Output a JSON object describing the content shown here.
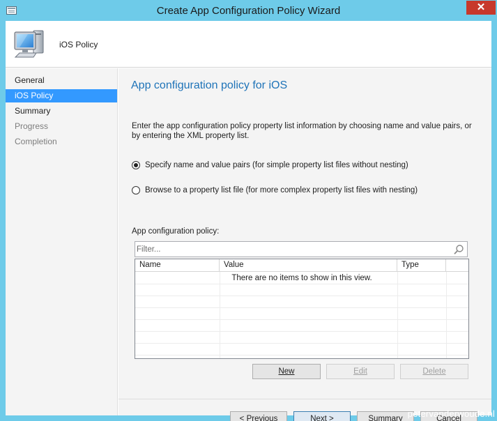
{
  "window": {
    "title": "Create App Configuration Policy Wizard",
    "close_glyph": "✕",
    "icon": "wizard-window-icon"
  },
  "header": {
    "label": "iOS Policy",
    "icon": "computer-monitor-icon"
  },
  "nav": {
    "items": [
      {
        "label": "General",
        "state": "normal"
      },
      {
        "label": "iOS Policy",
        "state": "selected"
      },
      {
        "label": "Summary",
        "state": "normal"
      },
      {
        "label": "Progress",
        "state": "disabled"
      },
      {
        "label": "Completion",
        "state": "disabled"
      }
    ]
  },
  "main": {
    "title": "App configuration policy for iOS",
    "description": "Enter the app configuration policy property list information by choosing name and value pairs, or by entering the XML property list.",
    "options": [
      {
        "label": "Specify name and value pairs (for simple property list files without nesting)",
        "checked": true
      },
      {
        "label": "Browse to a property list file (for more complex property list files with nesting)",
        "checked": false
      }
    ],
    "field_label": "App configuration policy:",
    "filter_placeholder": "Filter...",
    "table": {
      "columns": [
        "Name",
        "Value",
        "Type"
      ],
      "empty_message": "There are no items to show in this view."
    },
    "table_buttons": {
      "new": "New",
      "edit": "Edit",
      "delete": "Delete"
    }
  },
  "footer": {
    "previous": "< Previous",
    "next": "Next >",
    "summary": "Summary",
    "cancel": "Cancel"
  },
  "watermark": "petervanderwoude.nl",
  "colors": {
    "title_bar": "#6ecbe9",
    "close_button": "#c7392c",
    "selection": "#3399ff",
    "page_title": "#1e73b8"
  }
}
